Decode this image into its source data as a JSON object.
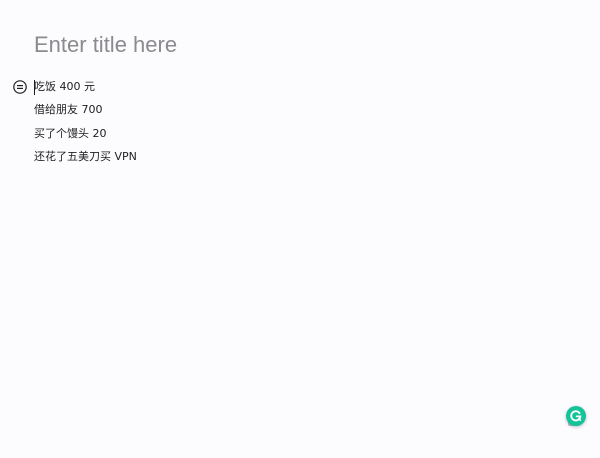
{
  "editor": {
    "title_placeholder": "Enter title here",
    "paragraphs": [
      "吃饭 400 元",
      "借给朋友 700",
      "买了个馒头 20",
      "还花了五美刀买 VPN"
    ],
    "block_handle_icon": "block-menu-icon",
    "colors": {
      "background": "#fcfbfe",
      "placeholder": "#8b8b8f",
      "text": "#1e1e1e"
    }
  },
  "grammarly": {
    "icon": "grammarly-icon",
    "color": "#15c39a"
  }
}
